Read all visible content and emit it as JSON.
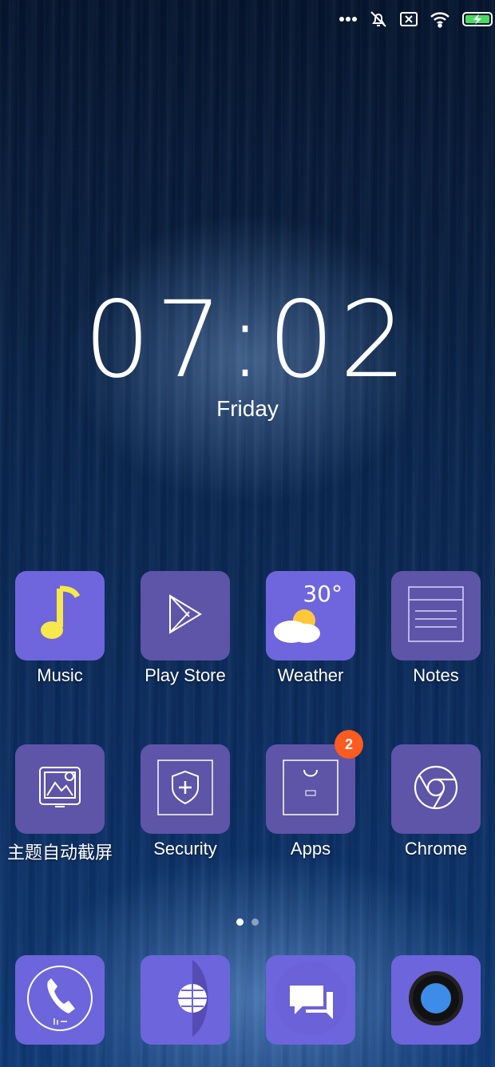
{
  "status_bar": {
    "icons": [
      "more-dots-icon",
      "alarm-off-icon",
      "sim-card-x-icon",
      "wifi-icon",
      "battery-charging-icon"
    ]
  },
  "lockscreen": {
    "time": "07:02",
    "day": "Friday"
  },
  "apps_row1": [
    {
      "label": "Music",
      "icon": "music-note-icon"
    },
    {
      "label": "Play Store",
      "icon": "play-store-icon"
    },
    {
      "label": "Weather",
      "icon": "weather-icon",
      "temperature": "30°"
    },
    {
      "label": "Notes",
      "icon": "notes-icon"
    }
  ],
  "apps_row2": [
    {
      "label": "主题自动截屏",
      "icon": "theme-screenshot-icon"
    },
    {
      "label": "Security",
      "icon": "security-shield-icon"
    },
    {
      "label": "Apps",
      "icon": "shopping-bag-icon",
      "badge": "2"
    },
    {
      "label": "Chrome",
      "icon": "chrome-icon"
    }
  ],
  "page_indicator": {
    "pages": 2,
    "active": 1
  },
  "dock": [
    {
      "icon": "phone-icon"
    },
    {
      "icon": "browser-globe-icon"
    },
    {
      "icon": "messages-icon"
    },
    {
      "icon": "camera-icon"
    }
  ],
  "colors": {
    "tile": "#5e54a8",
    "tile_light": "#6f66dd",
    "badge": "#ff5a1f",
    "music_note": "#f6e94b",
    "battery": "#4cd964"
  }
}
